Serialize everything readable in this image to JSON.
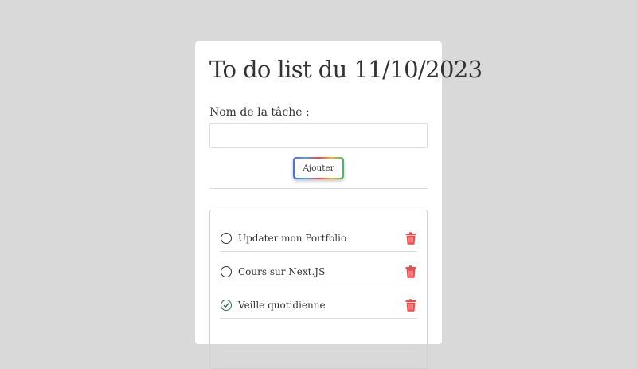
{
  "header": {
    "title": "To do list du 11/10/2023"
  },
  "form": {
    "label": "Nom de la tâche :",
    "input_value": "",
    "input_placeholder": "",
    "add_button_label": "Ajouter"
  },
  "tasks": [
    {
      "text": "Updater mon Portfolio",
      "done": false,
      "icon": "trash-icon"
    },
    {
      "text": "Cours sur Next.JS",
      "done": false,
      "icon": "trash-icon"
    },
    {
      "text": "Veille quotidienne",
      "done": true,
      "icon": "trash-icon"
    }
  ],
  "colors": {
    "delete": "#ee4b4b",
    "done_check": "#2e6b4f",
    "background": "#d9d9d9"
  }
}
